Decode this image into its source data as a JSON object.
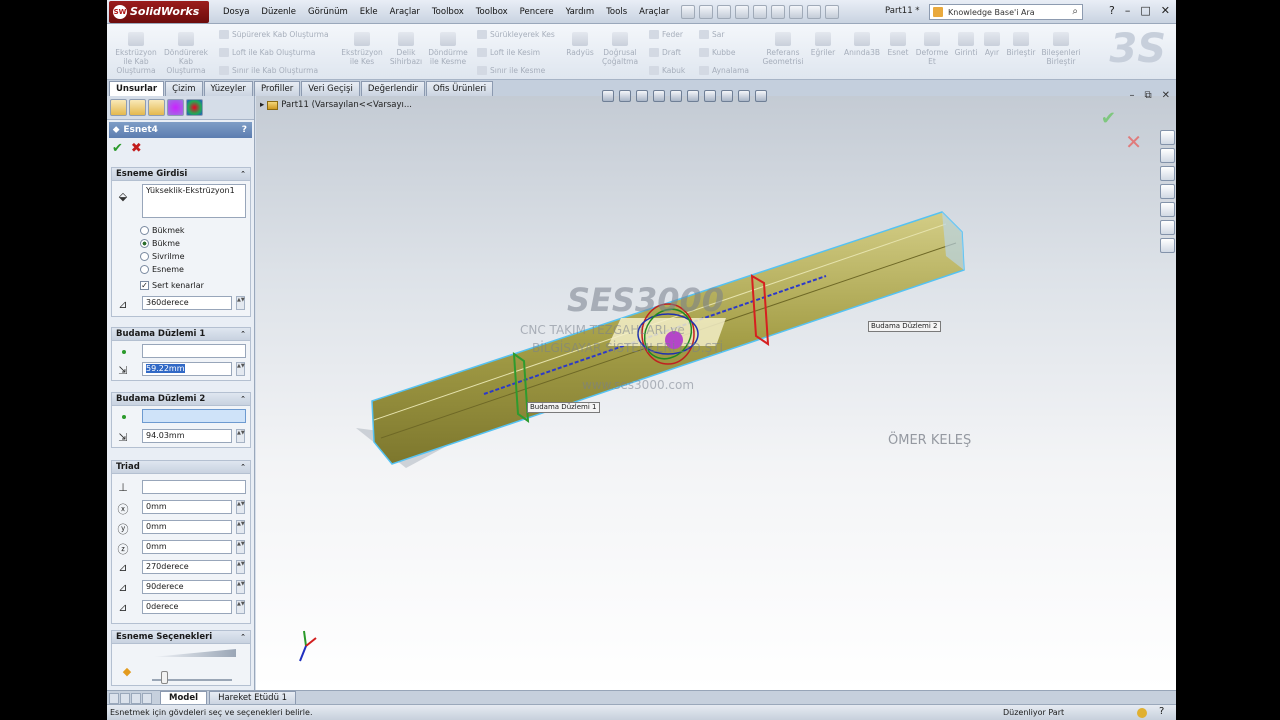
{
  "app": {
    "logo": "SolidWorks",
    "doc_title": "Part11 *"
  },
  "menu": [
    "Dosya",
    "Düzenle",
    "Görünüm",
    "Ekle",
    "Araçlar",
    "Toolbox",
    "Toolbox",
    "Pencere",
    "Yardım",
    "Tools",
    "Araçlar"
  ],
  "search": {
    "placeholder": "Knowledge Base'i Ara"
  },
  "window": {
    "help": "?",
    "minimize": "–",
    "restore": "□",
    "close": "✕"
  },
  "ribbon": {
    "b1": "Ekstrüzyon ile Kab Oluşturma",
    "b2": "Döndürerek Kab Oluşturma",
    "s1": "Süpürerek Kab Oluşturma",
    "s2": "Loft ile Kab Oluşturma",
    "s3": "Sınır ile Kab Oluşturma",
    "b3": "Ekstrüzyon ile Kes",
    "b4": "Delik Sihirbazı",
    "b5": "Döndürme ile Kesme",
    "s4": "Sürükleyerek Kes",
    "s5": "Loft ile Kesim",
    "s6": "Sınır ile Kesme",
    "b6": "Radyüs",
    "b7": "Doğrusal Çoğaltma",
    "s7": "Feder",
    "s8": "Draft",
    "s9": "Kabuk",
    "s10": "Sar",
    "s11": "Kubbe",
    "s12": "Aynalama",
    "b8": "Referans Geometrisi",
    "b9": "Eğriler",
    "b10": "Anında3B",
    "b11": "Esnet",
    "b12": "Deforme Et",
    "b13": "Girinti",
    "b14": "Ayır",
    "b15": "Birleştir",
    "b16": "Bileşenleri Birleştir"
  },
  "tabs": [
    "Unsurlar",
    "Çizim",
    "Yüzeyler",
    "Profiller",
    "Veri Geçişi",
    "Değerlendir",
    "Ofis Ürünleri"
  ],
  "panel": {
    "title": "Esnet4",
    "help": "?",
    "ok": "✔",
    "cancel": "✖",
    "input_group": {
      "title": "Esneme Girdisi",
      "body": "Yükseklik-Ekstrüzyon1",
      "options": [
        "Bükmek",
        "Bükme",
        "Sivrilme",
        "Esneme"
      ],
      "selected": "Bükme",
      "hard_edges_label": "Sert kenarlar",
      "hard_edges": true,
      "angle": "360derece"
    },
    "trim1": {
      "title": "Budama Düzlemi 1",
      "plane": "",
      "distance": "59.22mm"
    },
    "trim2": {
      "title": "Budama Düzlemi 2",
      "plane": "",
      "distance": "94.03mm"
    },
    "triad": {
      "title": "Triad",
      "ref": "",
      "x": "0mm",
      "y": "0mm",
      "z": "0mm",
      "rx": "270derece",
      "ry": "90derece",
      "rz": "0derece"
    },
    "options_group": {
      "title": "Esneme Seçenekleri",
      "accuracy": 0.15
    }
  },
  "viewport": {
    "tree": "Part11  (Varsayılan<<Varsayı...",
    "label_plane1": "Budama Düzlemi 1",
    "label_plane2": "Budama Düzlemi 2",
    "watermark_big": "SES3000",
    "watermark_l1": "CNC TAKIM TEZGAHLARI ve",
    "watermark_l2": "BİLGİSAYAR SİSTEMLERİ LTD.ŞTİ",
    "watermark_url": "www.ses3000.com",
    "author": "ÖMER KELEŞ"
  },
  "bottom_tabs": [
    "Model",
    "Hareket Etüdü 1"
  ],
  "status": {
    "message": "Esnetmek için gövdeleri seç ve seçenekleri belirle.",
    "mode": "Düzenliyor Part",
    "help": "?"
  },
  "colors": {
    "title_bar": "#5c7db0",
    "body": "#b3ad55",
    "accent_select": "#3169c6"
  }
}
